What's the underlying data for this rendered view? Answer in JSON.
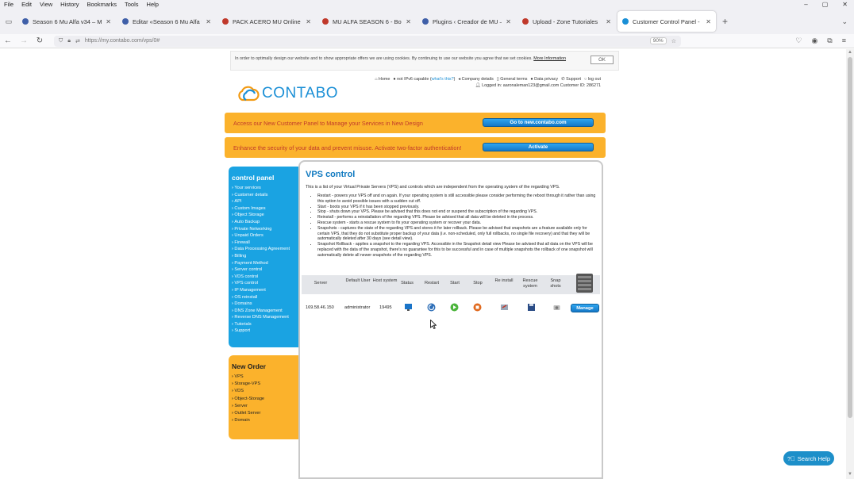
{
  "menubar": {
    "items": [
      "File",
      "Edit",
      "View",
      "History",
      "Bookmarks",
      "Tools",
      "Help"
    ],
    "window_controls": {
      "minimize": "–",
      "maximize": "▢",
      "close": "✕"
    }
  },
  "tabs": [
    {
      "title": "Season 6 Mu Alfa v34 – Mu Alfa",
      "color": "#3f5fa8",
      "active": false
    },
    {
      "title": "Editar «Season 6 Mu Alfa v34»",
      "color": "#3f5fa8",
      "active": false
    },
    {
      "title": "PACK ACERO MU Online Private",
      "color": "#c0392b",
      "active": false
    },
    {
      "title": "MU ALFA SEASON 6 - Bots Avanz",
      "color": "#c0392b",
      "active": false
    },
    {
      "title": "Plugins ‹ Creador de MU — W",
      "color": "#3f5fa8",
      "active": false
    },
    {
      "title": "Upload - Zone Tutoriales",
      "color": "#c0392b",
      "active": false
    },
    {
      "title": "Customer Control Panel - Conta",
      "color": "#1a8fd6",
      "active": true
    }
  ],
  "tabbar": {
    "new_tab": "+",
    "list_all": "⌄"
  },
  "navbar": {
    "url": "https://my.contabo.com/vps/0#",
    "zoom": "90%"
  },
  "cookie": {
    "text": "In order to optimally design our website and to show appropriate offers we are using cookies. By continuing to use our website you agree that we set cookies.",
    "more_info": "More Information",
    "ok": "OK"
  },
  "logo": {
    "name": "CONTABO"
  },
  "toplinks": {
    "home": "Home",
    "ipv6": "not IPv6 capable (",
    "whats_this": "what's this?",
    ")": ")",
    "company": "Company details",
    "terms": "General terms",
    "privacy": "Data privacy",
    "support": "Support",
    "logout": "log out",
    "logged_in": "Logged in: aaronaleman123@gmail.com Customer ID: 286271"
  },
  "banners": {
    "new_panel": {
      "msg": "Access our New Customer Panel to Manage your Services in New Design",
      "btn": "Go to new.contabo.com"
    },
    "two_factor": {
      "msg": "Enhance the security of your data and prevent misuse. Activate two-factor authentication!",
      "btn": "Activate"
    }
  },
  "control_panel": {
    "title": "control panel",
    "items": [
      "Your services",
      "Customer details",
      "API",
      "Custom Images",
      "Object Storage",
      "Auto Backup",
      "Private Networking",
      "Unpaid Orders",
      "Firewall",
      "Data Processing Agreement",
      "Billing",
      "Payment Method",
      "Server control",
      "VDS control",
      "VPS control",
      "IP Management",
      "OS reinstall",
      "Domains",
      "DNS Zone Management",
      "Reverse DNS Management",
      "Tutorials",
      "Support"
    ]
  },
  "new_order": {
    "title": "New Order",
    "items": [
      "VPS",
      "Storage-VPS",
      "VDS",
      "Object-Storage",
      "Server",
      "Outlet Server",
      "Domain"
    ]
  },
  "main": {
    "title": "VPS control",
    "intro": "This is a list of your Virtual Private Servers (VPS) and controls which are independent from the operating system of the regarding VPS.",
    "desc": [
      "Restart - powers your VPS off and on again. If your operating system is still accessible please consider performing the reboot through it rather than using this option to avoid possible issues with a sudden cut off.",
      "Start - boots your VPS if it has been stopped previously.",
      "Stop - shuts down your VPS. Please be advised that this does not end or suspend the subscription of the regarding VPS.",
      "Reinstall - performs a reinstallation of the regarding VPS. Please be advised that all data will be deleted in the process.",
      "Rescue system - starts a rescue system to fix your operating system or recover your data.",
      "Snapshots - captures the state of the regarding VPS and stores it for later rollback. Please be advised that snapshots are a feature available only for certain VPS, that they do not substitute proper backup of your data (i.e. non-scheduled, only full rollbacks, no single file recovery) and that they will be automatically deleted after 30 days (see detail view).",
      "Snapshot Rollback - applies a snapshot to the regarding VPS. Accessible in the Snapshot detail view Please be advised that all data on the VPS will be replaced with the data of the snapshot, there's no guarantee for this to be successful and in case of multiple snapshots the rollback of one snapshot will automatically delete all newer snapshots of the regarding VPS."
    ],
    "headers": {
      "server": "Server",
      "default_user": "Default User",
      "host_system": "Host system",
      "status": "Status",
      "restart": "Restart",
      "start": "Start",
      "stop": "Stop",
      "reinstall": "Re install",
      "rescue": "Rescue system",
      "snapshots": "Snap shots"
    },
    "row": {
      "server": "169.58.46.150",
      "user": "administrator",
      "host": "19495",
      "manage": "Manage"
    }
  },
  "help": {
    "label": "Search Help"
  },
  "colors": {
    "orange": "#fbb22c",
    "blue": "#1aa3e2",
    "title_blue": "#0f79c0"
  }
}
